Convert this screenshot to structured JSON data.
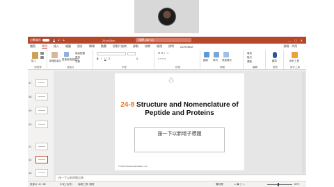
{
  "app": {
    "autosave_label": "自動儲存",
    "filename": "25.ch24ar...",
    "search_placeholder": "搜尋 (Alt+Q)",
    "window_controls": "— ◻ ✕"
  },
  "tabs": [
    "檔案",
    "常用",
    "插入",
    "繪圖",
    "設計",
    "轉場",
    "動畫",
    "投影片放映",
    "錄製",
    "校閱",
    "檢視",
    "說明",
    "ACROBAT"
  ],
  "active_tab": "常用",
  "tabs_right": "錄製  ·  共用",
  "ribbon": {
    "groups": [
      {
        "label": "剪貼簿"
      },
      {
        "label": "投影片"
      },
      {
        "label": "字型"
      },
      {
        "label": "段落"
      },
      {
        "label": "繪圖"
      },
      {
        "label": "編輯"
      },
      {
        "label": "語音"
      },
      {
        "label": "設計工具"
      }
    ],
    "paste": "貼上",
    "new_slide": "新增投影片",
    "reuse": "重複使用投影片",
    "layout": "版面配置",
    "reset": "重設",
    "section": "章節",
    "shapes": "圖案",
    "arrange": "排列",
    "quick_styles": "快速樣式",
    "find": "尋找",
    "replace": "取代",
    "select": "選取",
    "dictate": "聽寫",
    "designer": "設計工具"
  },
  "thumbnails": [
    {
      "num": "37"
    },
    {
      "num": "38"
    },
    {
      "num": "39"
    },
    {
      "num": "40"
    },
    {
      "num": "41"
    },
    {
      "num": "42"
    },
    {
      "num": "43"
    }
  ],
  "slide": {
    "number_label": "24-8",
    "title_rest": "Structure and Nomenclature of Peptide and Proteins",
    "subtitle_placeholder": "按一下以新增子標題",
    "copyright": "© 2017 Pearson Education, Inc."
  },
  "notes_placeholder": "按一下以新增備忘稿",
  "status": {
    "slide_count": "投影片 42 / 80",
    "language": "中文 (台灣)",
    "accessibility": "協助工具: 調查",
    "notes": "備忘稿",
    "zoom": "62%"
  }
}
